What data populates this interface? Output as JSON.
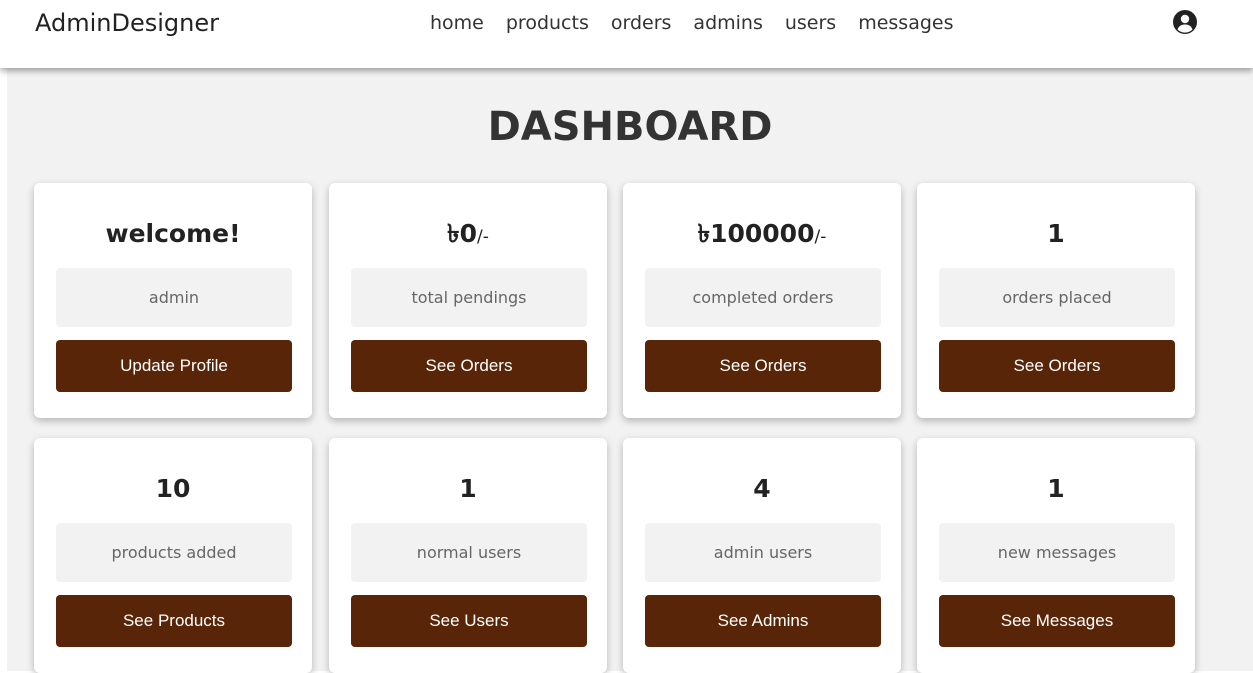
{
  "header": {
    "logo": "AdminDesigner",
    "nav": [
      "home",
      "products",
      "orders",
      "admins",
      "users",
      "messages"
    ],
    "profile_icon": "user-circle-icon"
  },
  "main": {
    "title": "DASHBOARD",
    "cards": [
      {
        "value": "welcome!",
        "suffix": "",
        "label": "admin",
        "button": "Update Profile"
      },
      {
        "value": "৳0",
        "suffix": "/-",
        "label": "total pendings",
        "button": "See Orders"
      },
      {
        "value": "৳100000",
        "suffix": "/-",
        "label": "completed orders",
        "button": "See Orders"
      },
      {
        "value": "1",
        "suffix": "",
        "label": "orders placed",
        "button": "See Orders"
      },
      {
        "value": "10",
        "suffix": "",
        "label": "products added",
        "button": "See Products"
      },
      {
        "value": "1",
        "suffix": "",
        "label": "normal users",
        "button": "See Users"
      },
      {
        "value": "4",
        "suffix": "",
        "label": "admin users",
        "button": "See Admins"
      },
      {
        "value": "1",
        "suffix": "",
        "label": "new messages",
        "button": "See Messages"
      }
    ]
  },
  "colors": {
    "button_bg": "#582508",
    "page_bg": "#f2f2f2"
  }
}
